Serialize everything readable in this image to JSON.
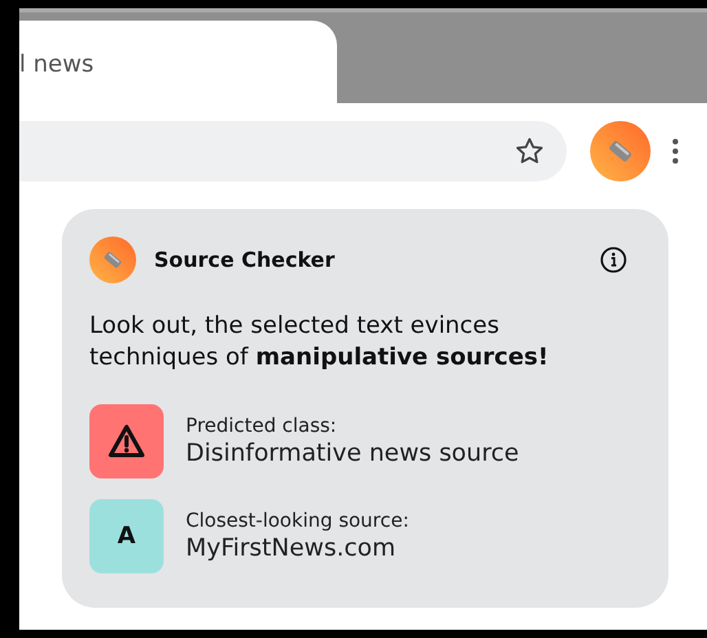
{
  "tab": {
    "title": "l news",
    "selected": true
  },
  "extension": {
    "title": "Source Checker"
  },
  "message": "Look out, the selected text evinces techniques of **manipulative sources!**",
  "results": [
    {
      "kind": "warning",
      "color": "#ff7373",
      "label": "Predicted class:",
      "value": "Disinformative news source"
    },
    {
      "kind": "letter",
      "color": "#9ce0de",
      "badge": "A",
      "label": "Closest-looking source:",
      "value": "MyFirstNews.com"
    }
  ]
}
